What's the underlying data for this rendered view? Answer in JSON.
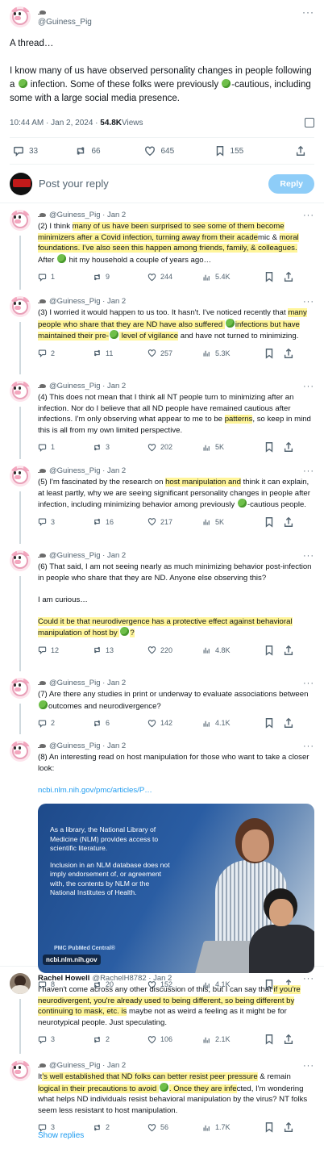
{
  "main": {
    "handle": "@Guiness_Pig",
    "more": "···",
    "p1": "A thread…",
    "p2_a": "I know many of us have observed personality changes in people following a ",
    "p2_b": " infection. Some of these folks were previously ",
    "p2_c": "-cautious, including some with a large social media presence.",
    "time": "10:44 AM · Jan 2, 2024 · ",
    "views_count": "54.8K",
    "views_label": " Views",
    "actions": {
      "replies": "33",
      "reposts": "66",
      "likes": "645",
      "bookmarks": "155"
    }
  },
  "reply_box": {
    "placeholder": "Post your reply",
    "button": "Reply"
  },
  "tweets": [
    {
      "name": "@Guiness_Pig",
      "date": "· Jan 2",
      "replies": "1",
      "reposts": "9",
      "likes": "244",
      "views": "5.4K"
    },
    {
      "name": "@Guiness_Pig",
      "date": "· Jan 2",
      "replies": "2",
      "reposts": "11",
      "likes": "257",
      "views": "5.3K"
    },
    {
      "name": "@Guiness_Pig",
      "date": "· Jan 2",
      "replies": "1",
      "reposts": "3",
      "likes": "202",
      "views": "5K"
    },
    {
      "name": "@Guiness_Pig",
      "date": "· Jan 2",
      "replies": "3",
      "reposts": "16",
      "likes": "217",
      "views": "5K"
    },
    {
      "name": "@Guiness_Pig",
      "date": "· Jan 2",
      "replies": "12",
      "reposts": "13",
      "likes": "220",
      "views": "4.8K"
    },
    {
      "name": "@Guiness_Pig",
      "date": "· Jan 2",
      "replies": "2",
      "reposts": "6",
      "likes": "142",
      "views": "4.1K"
    },
    {
      "name": "@Guiness_Pig",
      "date": "· Jan 2",
      "replies": "8",
      "reposts": "20",
      "likes": "152",
      "views": "4.1K"
    },
    {
      "name": "Rachel Howell",
      "handle": "@RachelH8782 · Jan 2",
      "replies": "3",
      "reposts": "2",
      "likes": "106",
      "views": "2.1K"
    },
    {
      "name": "@Guiness_Pig",
      "date": "· Jan 2",
      "replies": "3",
      "reposts": "2",
      "likes": "56",
      "views": "1.7K"
    }
  ],
  "t1": {
    "a": "(2) I think ",
    "hl1": "many of us have been surprised to see some of them become minimizers after a Covid infection, turning away from their acade",
    "b": "mic & ",
    "hl2": "moral foundations. I've also seen this happen among friends, family, & colleagues.",
    "c": " After ",
    "d": " hit my household a couple of years ago…"
  },
  "t2": {
    "a": "(3) I worried it would happen to us too. It hasn't. I've noticed recently that ",
    "hl1": "many people who share that they are ND have also suffered ",
    "hl2": "infections but have maintained their pre-",
    "hl3": " level of vigilance",
    "b": " and have not turned to minimizing."
  },
  "t3": {
    "a": "(4) This does not mean that I think all NT people turn to minimizing after an infection. Nor do I believe that all ND people have remained cautious after infections. I'm only observing what appear to me to be ",
    "hl": "patterns",
    "b": ", so keep in mind this is all from my own limited perspective."
  },
  "t4": {
    "a": "(5) I'm fascinated by the research on ",
    "hl": "host manipulation and",
    "b": " think it can explain, at least partly, why we are seeing significant personality changes in people after infection, including minimizing behavior among previously ",
    "c": "-cautious people."
  },
  "t5": {
    "p1": "(6) That said, I am not seeing nearly as much minimizing behavior post-infection in people who share that they are ND. Anyone else observing this?",
    "p2": "I am curious…",
    "hl": "Could it be that neurodivergence has a protective effect against behavioral manipulation of host by ",
    "hl_end": "?"
  },
  "t6": {
    "a": "(7) Are there any studies in print or underway to evaluate associations between ",
    "b": "outcomes and neurodivergence?"
  },
  "t7": {
    "p1": "(8) An interesting read on host manipulation for those who want to take a closer look:",
    "link": "ncbi.nlm.nih.gov/pmc/articles/P…",
    "card_p1": "As a library, the National Library of Medicine (NLM) provides access to scientific literature.",
    "card_p2": "Inclusion in an NLM database does not imply endorsement of, or agreement with, the contents by NLM or the National Institutes of Health.",
    "card_pmc": "PMC PubMed Central®",
    "card_domain": "ncbi.nlm.nih.gov"
  },
  "t8": {
    "a": "I haven't come across any other discussion of this, but I can say that ",
    "hl": "if you're neurodivergent, you're already used to being different, so being different by continuing to mask, etc. is",
    "b": " maybe not as weird a feeling as it might be for neurotypical people.  Just speculating."
  },
  "t9": {
    "a": "It",
    "hl1": "'s well established that ND folks can better resist peer pressure",
    "b": " & remain ",
    "hl2": "logical in their precautions to avoid ",
    "hl3": ". Once they are infe",
    "c": "cted, I'm wondering what helps ND individuals resist behavioral manipulation by the virus? NT folks seem less resistant to host manipulation."
  },
  "show_replies": "Show replies"
}
